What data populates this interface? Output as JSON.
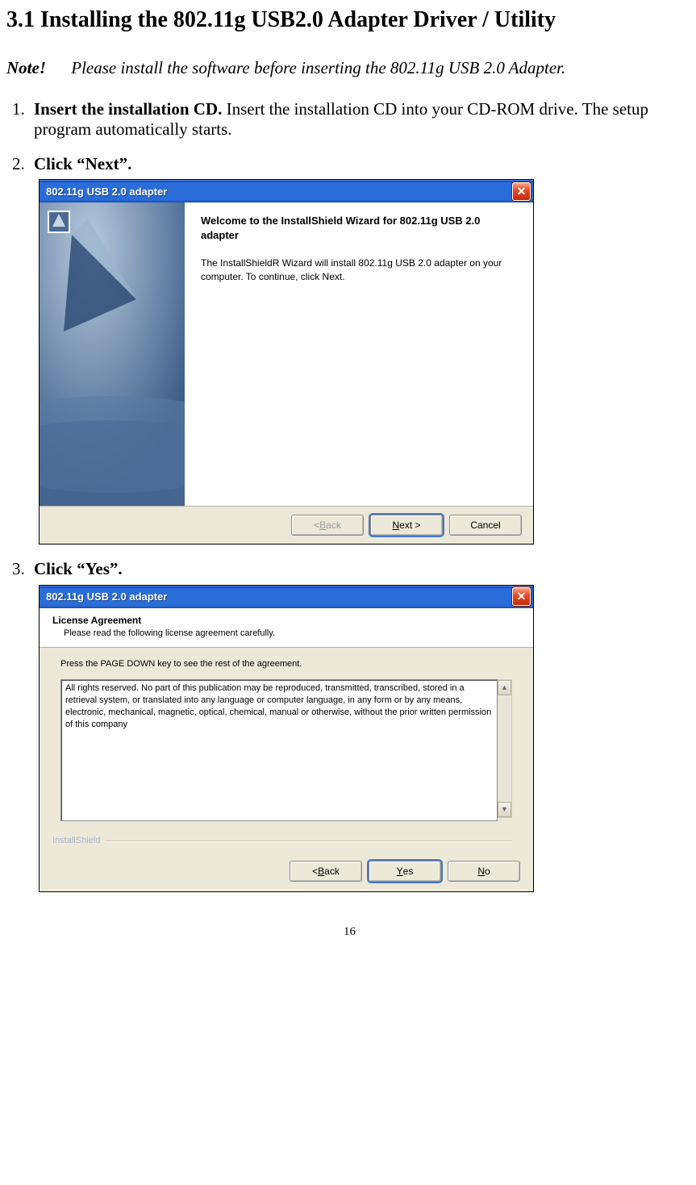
{
  "heading": "3.1 Installing the 802.11g USB2.0 Adapter Driver / Utility",
  "note": {
    "label": "Note!",
    "text": "Please install the software before inserting the 802.11g USB 2.0 Adapter."
  },
  "steps": {
    "s1": {
      "bold": "Insert the installation CD.",
      "rest": "    Insert the installation CD into your CD-ROM drive. The setup program automatically starts."
    },
    "s2": {
      "bold": "Click “Next”."
    },
    "s3": {
      "bold": "Click “Yes”."
    }
  },
  "window1": {
    "title": "802.11g USB 2.0 adapter",
    "heading": "Welcome to the InstallShield Wizard for 802.11g USB 2.0 adapter",
    "para": "The InstallShieldR Wizard will install 802.11g USB 2.0 adapter on your computer.  To continue, click Next.",
    "buttons": {
      "back_prefix": "< ",
      "back_u": "B",
      "back_suffix": "ack",
      "next_u": "N",
      "next_suffix": "ext >",
      "cancel": "Cancel"
    }
  },
  "window2": {
    "title": "802.11g USB 2.0 adapter",
    "header_title": "License Agreement",
    "header_sub": "Please read the following license agreement carefully.",
    "instruction": "Press the PAGE DOWN key to see the rest of the agreement.",
    "license_text": "All rights reserved. No part of this publication may be reproduced, transmitted, transcribed, stored in a retrieval system, or translated into any language or computer language, in any form or by any means, electronic, mechanical, magnetic, optical, chemical, manual or otherwise, without the prior written permission of this company",
    "brand": "InstallShield",
    "buttons": {
      "back_prefix": "< ",
      "back_u": "B",
      "back_suffix": "ack",
      "yes_u": "Y",
      "yes_suffix": "es",
      "no_u": "N",
      "no_suffix": "o"
    }
  },
  "page_number": "16"
}
